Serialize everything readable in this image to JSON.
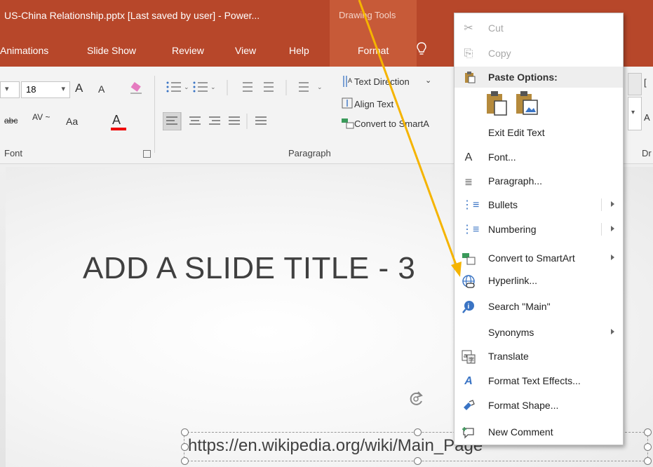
{
  "window": {
    "title": "US-China Relationship.pptx [Last saved by user]  -  Power...",
    "contextual_tab_group": "Drawing Tools"
  },
  "tabs": [
    "Animations",
    "Slide Show",
    "Review",
    "View",
    "Help",
    "Format"
  ],
  "ribbon": {
    "font": {
      "size": "18",
      "grow": "A",
      "shrink": "A",
      "change_case": "Aa",
      "font_color": "A",
      "group_label": "Font"
    },
    "paragraph": {
      "text_direction": "Text Direction",
      "align_text": "Align Text",
      "convert_smartart": "Convert to SmartA",
      "group_label": "Paragraph"
    },
    "drawing": {
      "group_label": "Dr",
      "arrange": "A"
    }
  },
  "slide": {
    "title": "ADD A SLIDE TITLE - 3",
    "url_text": "https://en.wikipedia.org/wiki/Main_Page"
  },
  "context_menu": {
    "cut": "Cut",
    "copy": "Copy",
    "paste_options": "Paste Options:",
    "exit_edit_text": "Exit Edit Text",
    "font": "Font...",
    "paragraph": "Paragraph...",
    "bullets": "Bullets",
    "numbering": "Numbering",
    "convert_smartart": "Convert to SmartArt",
    "hyperlink": "Hyperlink...",
    "search": "Search \"Main\"",
    "synonyms": "Synonyms",
    "translate": "Translate",
    "format_text_effects": "Format Text Effects...",
    "format_shape": "Format Shape...",
    "new_comment": "New Comment"
  },
  "colors": {
    "title_bar": "#b7472a",
    "contextual_tab": "#c75a38",
    "annotation_arrow": "#f5b400"
  }
}
